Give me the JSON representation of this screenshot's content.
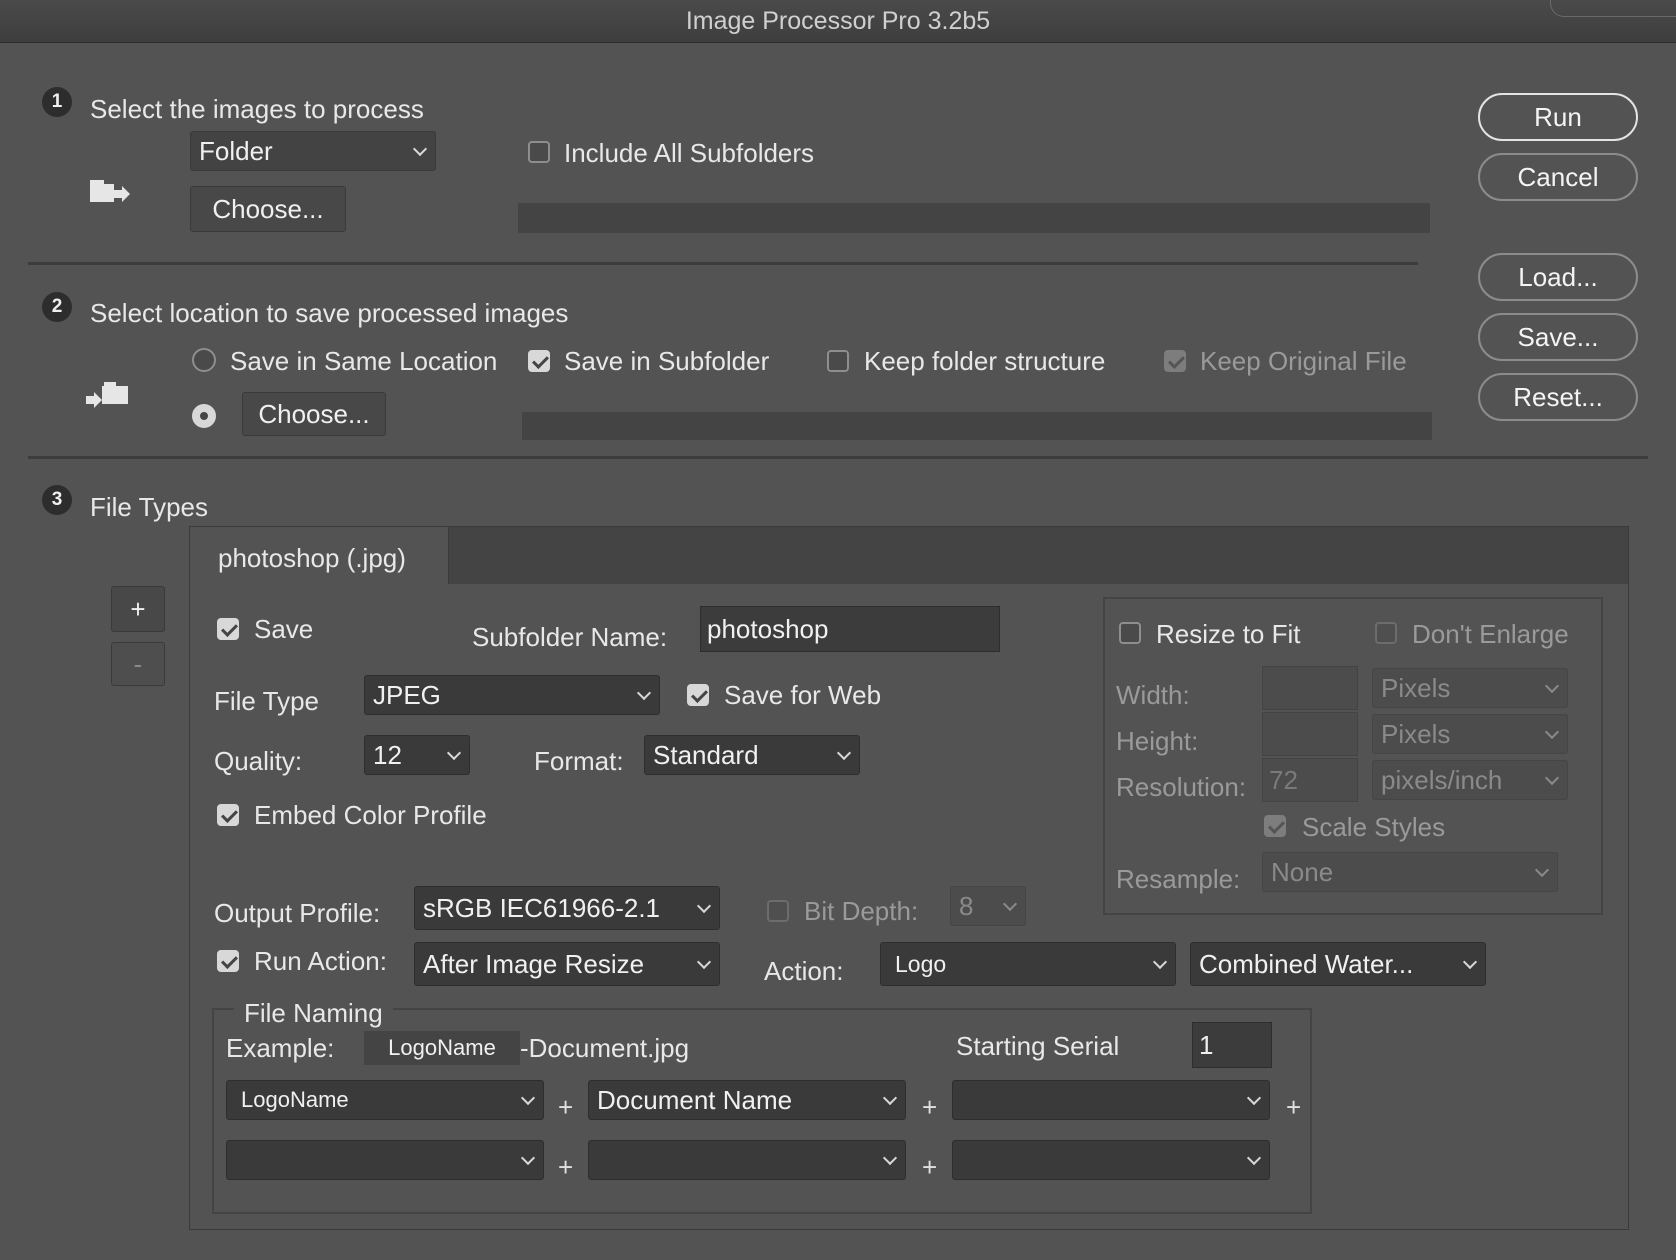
{
  "window": {
    "title": "Image Processor Pro 3.2b5"
  },
  "buttons": {
    "run": "Run",
    "cancel": "Cancel",
    "load": "Load...",
    "save": "Save...",
    "reset": "Reset..."
  },
  "section1": {
    "number": "1",
    "heading": "Select the images to process",
    "source_select": "Folder",
    "choose": "Choose...",
    "include_subfolders": "Include All Subfolders",
    "path": ""
  },
  "section2": {
    "number": "2",
    "heading": "Select location to save processed images",
    "save_same_location": "Save in Same Location",
    "save_in_subfolder": "Save in Subfolder",
    "keep_folder_structure": "Keep folder structure",
    "keep_original_file": "Keep Original File",
    "choose": "Choose...",
    "path": ""
  },
  "section3": {
    "number": "3",
    "heading": "File Types",
    "add": "+",
    "remove": "-",
    "tab": "photoshop (.jpg)",
    "save": "Save",
    "subfolder_label": "Subfolder Name:",
    "subfolder_value": "photoshop",
    "file_type_label": "File Type",
    "file_type_value": "JPEG",
    "save_for_web": "Save for Web",
    "quality_label": "Quality:",
    "quality_value": "12",
    "format_label": "Format:",
    "format_value": "Standard",
    "embed_profile": "Embed Color Profile",
    "output_profile_label": "Output Profile:",
    "output_profile_value": "sRGB IEC61966-2.1",
    "bit_depth_label": "Bit Depth:",
    "bit_depth_value": "8",
    "run_action_label": "Run Action:",
    "run_action_value": "After Image Resize",
    "action_label": "Action:",
    "action_set": "Logo",
    "action_name": "Combined Water..."
  },
  "resize": {
    "resize_to_fit": "Resize to Fit",
    "dont_enlarge": "Don't Enlarge",
    "width_label": "Width:",
    "width_value": "",
    "width_unit": "Pixels",
    "height_label": "Height:",
    "height_value": "",
    "height_unit": "Pixels",
    "resolution_label": "Resolution:",
    "resolution_value": "72",
    "resolution_unit": "pixels/inch",
    "scale_styles": "Scale Styles",
    "resample_label": "Resample:",
    "resample_value": "None"
  },
  "file_naming": {
    "legend": "File Naming",
    "example_label": "Example:",
    "example_token": "LogoName",
    "example_rest": "-Document.jpg",
    "starting_serial_label": "Starting Serial",
    "starting_serial_value": "1",
    "fields": [
      "LogoName",
      "Document Name",
      "",
      "",
      "",
      ""
    ],
    "plus": "+"
  }
}
